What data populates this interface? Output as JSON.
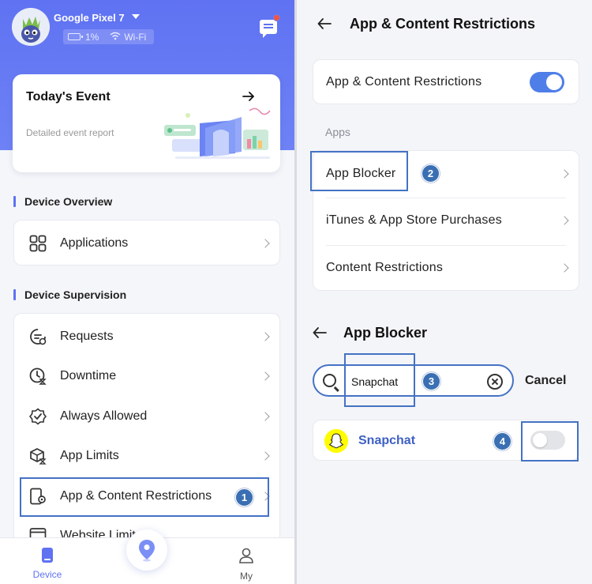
{
  "device": {
    "name": "Google Pixel 7",
    "battery": "1%",
    "network": "Wi-Fi"
  },
  "event_card": {
    "title": "Today's Event",
    "subtitle": "Detailed event report"
  },
  "sections": {
    "overview_label": "Device Overview",
    "supervision_label": "Device Supervision"
  },
  "overview_items": [
    {
      "label": "Applications",
      "icon": "grid-icon"
    }
  ],
  "supervision_items": [
    {
      "label": "Requests",
      "icon": "request-icon"
    },
    {
      "label": "Downtime",
      "icon": "downtime-clock-icon"
    },
    {
      "label": "Always Allowed",
      "icon": "check-shield-icon"
    },
    {
      "label": "App Limits",
      "icon": "app-limit-icon"
    },
    {
      "label": "App & Content Restrictions",
      "icon": "restriction-gear-icon"
    },
    {
      "label": "Website Limits",
      "icon": "browser-icon"
    }
  ],
  "bottom_nav": {
    "device": "Device",
    "my": "My"
  },
  "restrictions_page": {
    "title": "App & Content Restrictions",
    "master_toggle_label": "App & Content Restrictions",
    "master_toggle_on": true,
    "apps_section_label": "Apps",
    "items": [
      {
        "label": "App Blocker"
      },
      {
        "label": "iTunes & App Store Purchases"
      },
      {
        "label": "Content Restrictions"
      }
    ]
  },
  "app_blocker": {
    "title": "App Blocker",
    "search_value": "Snapchat",
    "cancel_label": "Cancel",
    "results": [
      {
        "name": "Snapchat",
        "blocked": false
      }
    ]
  },
  "step_badges": [
    "1",
    "2",
    "3",
    "4"
  ],
  "colors": {
    "accent": "#5f72f2",
    "toggle_on": "#4f7ee8",
    "highlight": "#4472c4",
    "badge": "#3a6fb3",
    "snapchat_link": "#3d5fc4"
  }
}
